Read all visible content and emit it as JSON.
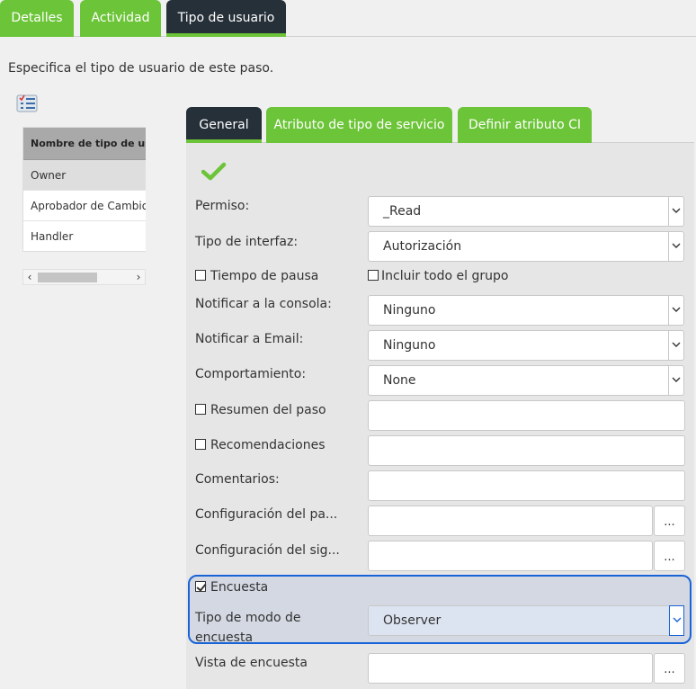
{
  "top_tabs": [
    {
      "label": "Detalles"
    },
    {
      "label": "Actividad"
    },
    {
      "label": "Tipo de usuario"
    }
  ],
  "description": "Especifica el tipo de usuario de este paso.",
  "user_table": {
    "header": "Nombre de tipo de usuario",
    "rows": [
      "Owner",
      "Aprobador de Cambios",
      "Handler"
    ]
  },
  "scrollbar": {
    "left_arrow": "‹",
    "right_arrow": "›"
  },
  "sub_tabs": [
    {
      "label": "General"
    },
    {
      "label": "Atributo de tipo de servicio"
    },
    {
      "label": "Definir atributo CI"
    }
  ],
  "form": {
    "permiso": {
      "label": "Permiso:",
      "value": "_Read"
    },
    "tipo_interfaz": {
      "label": "Tipo de interfaz:",
      "value": "Autorización"
    },
    "tiempo_pausa": {
      "label": "Tiempo de pausa"
    },
    "incluir_grupo": {
      "label": "Incluir todo el grupo"
    },
    "notificar_consola": {
      "label": "Notificar a la consola:",
      "value": "Ninguno"
    },
    "notificar_email": {
      "label": "Notificar a Email:",
      "value": "Ninguno"
    },
    "comportamiento": {
      "label": "Comportamiento:",
      "value": "None"
    },
    "resumen_paso": {
      "label": "Resumen del paso"
    },
    "recomendaciones": {
      "label": "Recomendaciones"
    },
    "comentarios": {
      "label": "Comentarios:"
    },
    "config_pa": {
      "label": "Configuración del pa...",
      "button": "..."
    },
    "config_sig": {
      "label": "Configuración del sig...",
      "button": "..."
    },
    "encuesta": {
      "label": "Encuesta"
    },
    "tipo_modo_encuesta": {
      "label_line1": "Tipo de modo de",
      "label_line2": "encuesta",
      "value": "Observer"
    },
    "vista_encuesta": {
      "label": "Vista de encuesta",
      "button": "..."
    }
  },
  "colors": {
    "accent_green": "#6cc438",
    "tab_dark": "#263038",
    "highlight_blue": "#1a63d6"
  },
  "icons": {
    "list": "checklist-icon",
    "ok": "checkmark-icon",
    "dropdown": "chevron-down-icon"
  }
}
